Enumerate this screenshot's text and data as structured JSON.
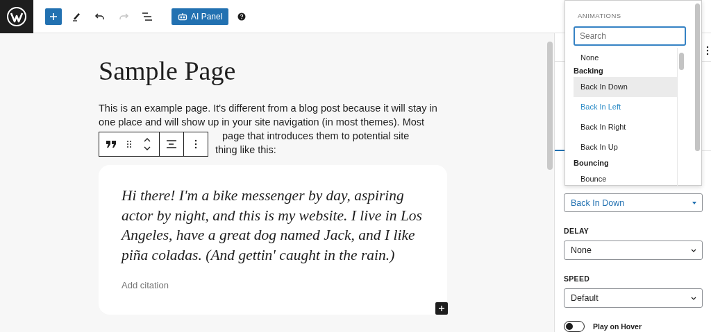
{
  "topbar": {
    "actions": [
      {
        "kind": "inserter",
        "disabled": false
      },
      {
        "kind": "tools",
        "disabled": false
      },
      {
        "kind": "undo",
        "disabled": false
      },
      {
        "kind": "redo",
        "disabled": true
      },
      {
        "kind": "list_view",
        "disabled": false
      },
      {
        "kind": "ai_panel",
        "label": "AI Panel",
        "disabled": false
      },
      {
        "kind": "help",
        "disabled": false
      }
    ]
  },
  "editor": {
    "title": "Sample Page",
    "paragraph_lines": [
      "This is an example page. It's different from a blog post because it will stay in",
      "one place and will show up in your site navigation (in most themes). Most"
    ],
    "lines_beside_toolbar": [
      "page that introduces them to potential site",
      "thing like this:"
    ],
    "block_toolbar": [
      {
        "kind": "quote"
      },
      {
        "kind": "drag"
      },
      {
        "kind": "move"
      },
      {
        "kind": "align"
      },
      {
        "kind": "more"
      }
    ],
    "quote": {
      "text": "Hi there! I'm a bike messenger by day, aspiring actor by night, and this is my website. I live in Los Angeles, have a great dog named Jack, and I like piña coladas. (And gettin' caught in the rain.)",
      "citation": {
        "placeholder": "Add citation"
      }
    }
  },
  "sidebar": {
    "animation_select": {
      "value": "Back In Down"
    },
    "fields": [
      {
        "label": "DELAY",
        "value": "None"
      },
      {
        "label": "SPEED",
        "value": "Default"
      }
    ],
    "toggle": {
      "label": "Play on Hover",
      "on": false
    }
  },
  "popover": {
    "heading": "ANIMATIONS",
    "search": {
      "placeholder": "Search"
    },
    "options": [
      {
        "kind": "option",
        "label": "None",
        "selected": false,
        "hovered": false
      },
      {
        "kind": "group",
        "label": "Backing"
      },
      {
        "kind": "option",
        "label": "Back In Down",
        "selected": true,
        "hovered": false
      },
      {
        "kind": "option",
        "label": "Back In Left",
        "selected": false,
        "hovered": true
      },
      {
        "kind": "option",
        "label": "Back In Right",
        "selected": false,
        "hovered": false
      },
      {
        "kind": "option",
        "label": "Back In Up",
        "selected": false,
        "hovered": false
      },
      {
        "kind": "group",
        "label": "Bouncing"
      },
      {
        "kind": "option",
        "label": "Bounce",
        "selected": false,
        "hovered": false
      }
    ]
  }
}
